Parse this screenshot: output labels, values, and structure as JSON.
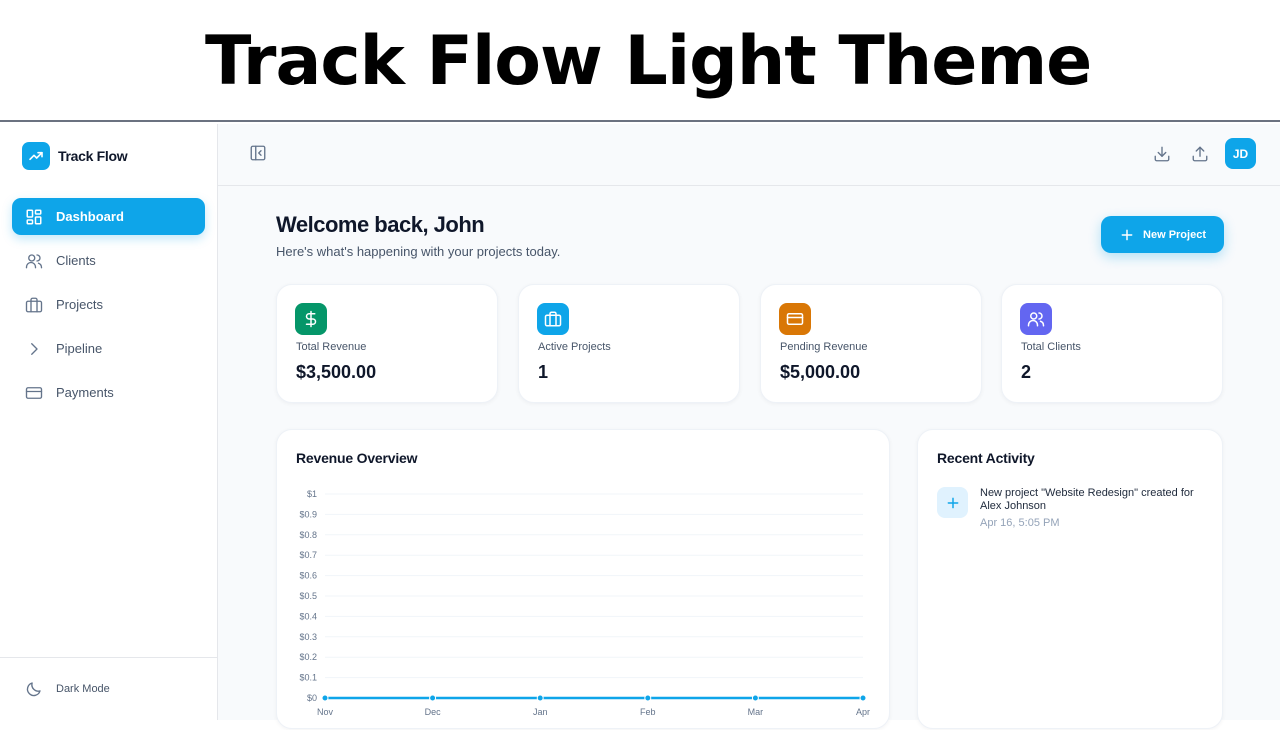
{
  "banner": {
    "title": "Track Flow Light Theme"
  },
  "brand": {
    "name": "Track Flow",
    "logo_icon": "trending-up-icon",
    "color": "#0ea5e9"
  },
  "sidebar": {
    "items": [
      {
        "label": "Dashboard",
        "icon": "layout-grid-icon",
        "active": true
      },
      {
        "label": "Clients",
        "icon": "users-icon",
        "active": false
      },
      {
        "label": "Projects",
        "icon": "briefcase-icon",
        "active": false
      },
      {
        "label": "Pipeline",
        "icon": "chevron-right-icon",
        "active": false
      },
      {
        "label": "Payments",
        "icon": "credit-card-icon",
        "active": false
      }
    ],
    "footer": {
      "label": "Dark Mode",
      "icon": "moon-icon"
    }
  },
  "topbar": {
    "collapse_icon": "panel-left-close-icon",
    "actions": [
      "download-icon",
      "upload-icon"
    ],
    "avatar": "JD"
  },
  "welcome": {
    "title": "Welcome back, John",
    "subtitle": "Here's what's happening with your projects today."
  },
  "new_project": {
    "label": "New Project",
    "icon": "plus-icon"
  },
  "stats": [
    {
      "label": "Total Revenue",
      "value": "$3,500.00",
      "icon": "dollar-icon",
      "color": "#059669"
    },
    {
      "label": "Active Projects",
      "value": "1",
      "icon": "briefcase-icon",
      "color": "#0ea5e9"
    },
    {
      "label": "Pending Revenue",
      "value": "$5,000.00",
      "icon": "credit-card-icon",
      "color": "#d97706"
    },
    {
      "label": "Total Clients",
      "value": "2",
      "icon": "users-icon",
      "color": "#6366f1"
    }
  ],
  "revenue": {
    "title": "Revenue Overview"
  },
  "chart_data": {
    "type": "line",
    "title": "Revenue Overview",
    "xlabel": "",
    "ylabel": "",
    "categories": [
      "Nov",
      "Dec",
      "Jan",
      "Feb",
      "Mar",
      "Apr"
    ],
    "series": [
      {
        "values": [
          0,
          0,
          0,
          0,
          0,
          0
        ],
        "color": "#0ea5e9"
      }
    ],
    "ylim": [
      0,
      1
    ],
    "yticks": [
      "$0",
      "$0.1",
      "$0.2",
      "$0.3",
      "$0.4",
      "$0.5",
      "$0.6",
      "$0.7",
      "$0.8",
      "$0.9",
      "$1"
    ],
    "grid": true
  },
  "activity": {
    "title": "Recent Activity",
    "items": [
      {
        "text": "New project \"Website Redesign\" created for Alex Johnson",
        "time": "Apr 16, 5:05 PM",
        "icon": "plus-icon"
      }
    ]
  }
}
